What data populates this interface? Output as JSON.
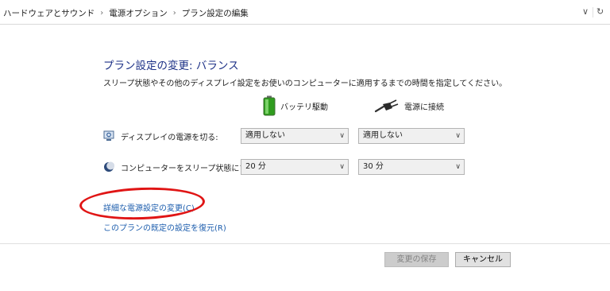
{
  "breadcrumb": {
    "items": [
      "ハードウェアとサウンド",
      "電源オプション",
      "プラン設定の編集"
    ],
    "separator": "›"
  },
  "toolbar": {
    "dropdown_glyph": "∨",
    "refresh_glyph": "↻"
  },
  "page": {
    "title": "プラン設定の変更: バランス",
    "description": "スリープ状態やその他のディスプレイ設定をお使いのコンピューターに適用するまでの時間を指定してください。"
  },
  "columns": {
    "battery": {
      "label": "バッテリ駆動",
      "icon": "battery-icon"
    },
    "plugged": {
      "label": "電源に接続",
      "icon": "power-plug-icon"
    }
  },
  "settings": [
    {
      "label": "ディスプレイの電源を切る:",
      "icon": "display-icon",
      "battery_value": "適用しない",
      "plugged_value": "適用しない"
    },
    {
      "label": "コンピューターをスリープ状態にする:",
      "icon": "sleep-moon-icon",
      "battery_value": "20 分",
      "plugged_value": "30 分"
    }
  ],
  "links": {
    "advanced": "詳細な電源設定の変更(C)",
    "restore": "このプランの既定の設定を復元(R)"
  },
  "buttons": {
    "save": "変更の保存",
    "cancel": "キャンセル"
  },
  "dropdown_chevron": "∨",
  "colors": {
    "title": "#1e3287",
    "link": "#1c5dad",
    "annotation": "#e01515",
    "battery_green": "#3fbf2a"
  }
}
